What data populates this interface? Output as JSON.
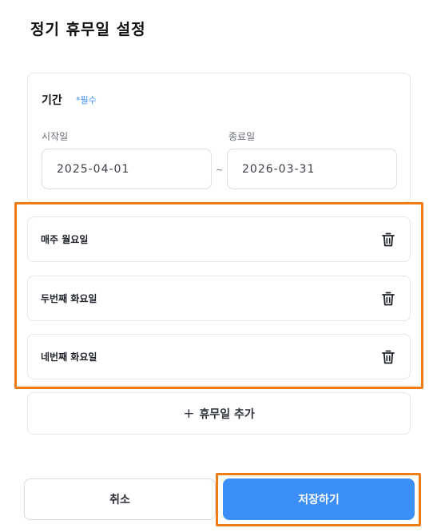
{
  "page": {
    "title": "정기 휴무일 설정"
  },
  "period": {
    "label": "기간",
    "required": "*필수",
    "start_label": "시작일",
    "end_label": "종료일",
    "start_value": "2025-04-01",
    "end_value": "2026-03-31",
    "separator": "~"
  },
  "holidays": [
    {
      "name": "매주 월요일",
      "icon": "trash-icon"
    },
    {
      "name": "두번째 화요일",
      "icon": "trash-icon"
    },
    {
      "name": "네번째 화요일",
      "icon": "trash-icon"
    }
  ],
  "actions": {
    "add_icon": "+",
    "add_label": "휴무일 추가",
    "cancel_label": "취소",
    "save_label": "저장하기"
  },
  "colors": {
    "accent": "#3b8ff6",
    "required": "#3d8bf7",
    "highlight": "#f07c14",
    "border": "#e3e6ea"
  }
}
